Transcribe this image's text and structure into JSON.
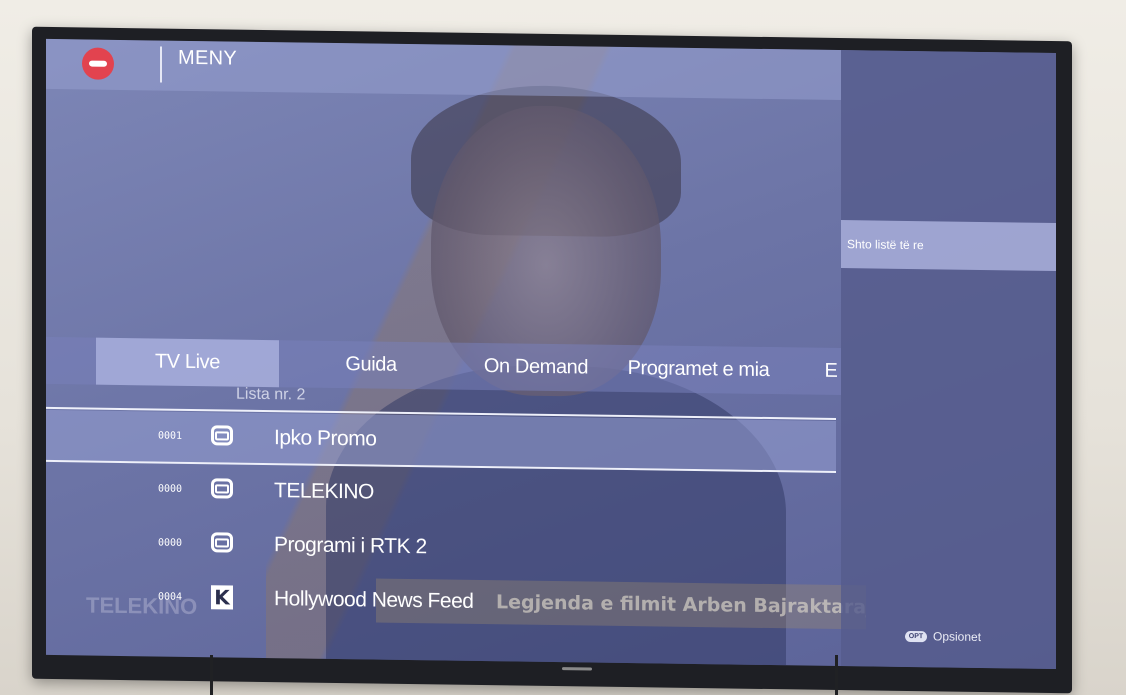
{
  "header": {
    "title": "MENY"
  },
  "tabs": [
    {
      "label": "TV Live",
      "active": true
    },
    {
      "label": "Guida",
      "active": false
    },
    {
      "label": "On Demand",
      "active": false
    },
    {
      "label": "Programet e mia",
      "active": false
    },
    {
      "label": "E",
      "active": false
    }
  ],
  "list": {
    "title": "Lista nr. 2",
    "channels": [
      {
        "number": "0001",
        "name": "Ipko Promo",
        "selected": true,
        "icon": "tv-icon"
      },
      {
        "number": "0000",
        "name": "TELEKINO",
        "selected": false,
        "icon": "tv-icon"
      },
      {
        "number": "0000",
        "name": "Programi i RTK 2",
        "selected": false,
        "icon": "tv-icon"
      },
      {
        "number": "0004",
        "name": "Hollywood News Feed",
        "selected": false,
        "icon": "kanal-k-logo-icon"
      }
    ]
  },
  "side_panel": {
    "item": "Shto listë të re",
    "options_label": "Opsionet",
    "options_button": "OPT"
  },
  "video_overlay": {
    "caption": "Legjenda e filmit Arben Bajraktaraj",
    "watermark": "TELEKINO"
  },
  "colors": {
    "back_button": "#e2434f",
    "screen_tint": "#6c74a6",
    "panel": "#555c8c"
  }
}
